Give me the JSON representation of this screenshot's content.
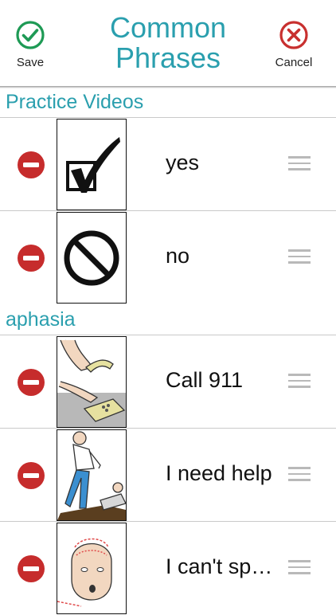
{
  "header": {
    "title_line1": "Common",
    "title_line2": "Phrases",
    "save_label": "Save",
    "cancel_label": "Cancel",
    "save_icon": "check-circle-icon",
    "cancel_icon": "x-circle-icon"
  },
  "sections": [
    {
      "name": "Practice Videos",
      "items": [
        {
          "label": "yes",
          "image": "checkmark-box-image"
        },
        {
          "label": "no",
          "image": "no-symbol-image"
        }
      ]
    },
    {
      "name": "aphasia",
      "items": [
        {
          "label": "Call 911",
          "image": "phone-dial-image"
        },
        {
          "label": "I need help",
          "image": "person-helping-image"
        },
        {
          "label": "I can't sp…",
          "image": "head-scrambled-words-image"
        }
      ]
    }
  ],
  "colors": {
    "accent": "#2a9fae",
    "save": "#1e9a55",
    "cancel": "#c8302f",
    "delete": "#c62c2c"
  }
}
